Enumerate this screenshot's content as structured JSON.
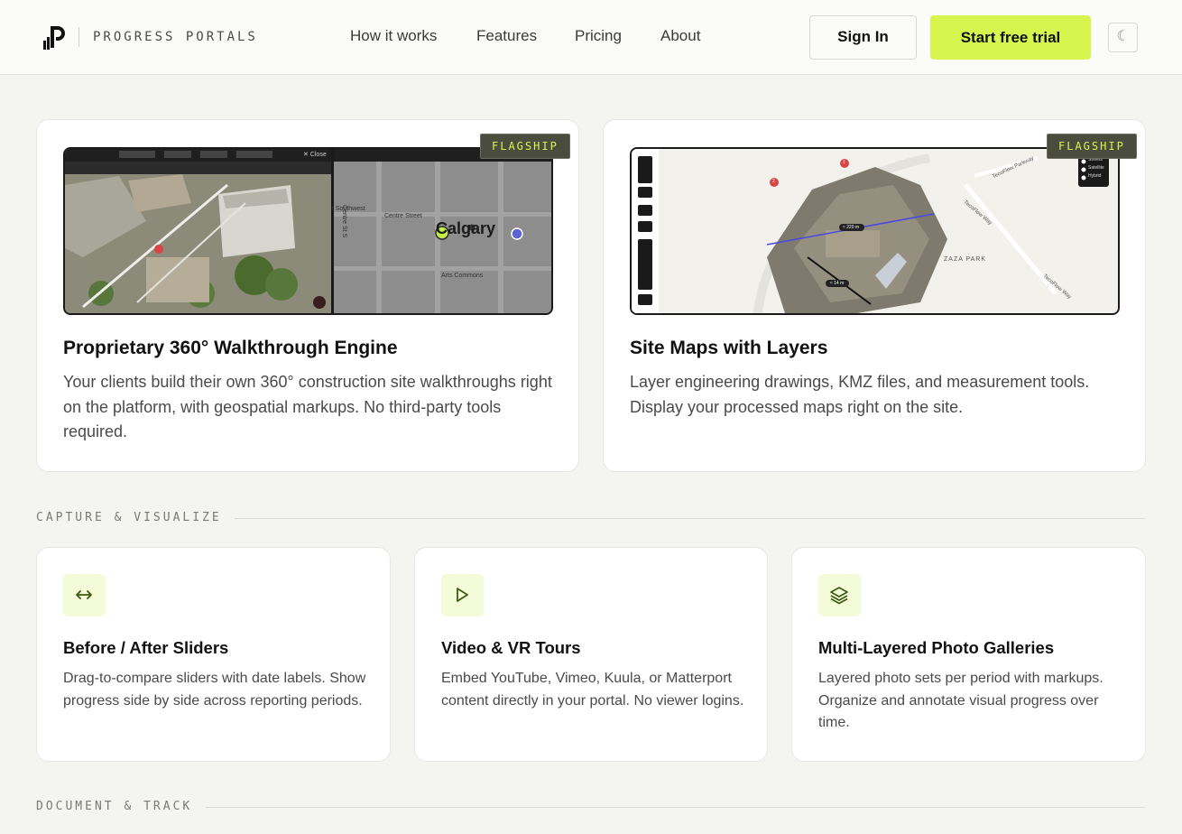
{
  "brand": {
    "name": "PROGRESS PORTALS"
  },
  "nav": {
    "items": [
      "How it works",
      "Features",
      "Pricing",
      "About"
    ],
    "sign_in": "Sign In",
    "start_trial": "Start free trial",
    "theme_toggle_glyph": "☾"
  },
  "flagship": [
    {
      "badge": "FLAGSHIP",
      "title": "Proprietary 360° Walkthrough Engine",
      "description": "Your clients build their own 360° construction site walkthroughs right on the platform, with geospatial markups. No third-party tools required.",
      "screenshot": {
        "map_city": "Calgary",
        "map_labels": [
          "t Southwest",
          "Centre Street",
          "Centre St S",
          "Arts Commons"
        ],
        "close_label": "✕ Close"
      }
    },
    {
      "badge": "FLAGSHIP",
      "title": "Site Maps with Layers",
      "description": "Layer engineering drawings, KMZ files, and measurement tools. Display your processed maps right on the site.",
      "screenshot": {
        "layer_options": [
          "Streets",
          "Satellite",
          "Hybrid"
        ],
        "map_labels": [
          "ZAZA PARK",
          "TecoFlow Parkway",
          "TecoFlow Way",
          "TecoFlow Way"
        ],
        "measure_labels": [
          "≈ 220 m",
          "≈ 14 m"
        ],
        "markers": [
          "1",
          "2"
        ]
      }
    }
  ],
  "sections": [
    {
      "label": "CAPTURE & VISUALIZE",
      "cards": [
        {
          "icon": "arrows-horizontal-icon",
          "title": "Before / After Sliders",
          "description": "Drag-to-compare sliders with date labels. Show progress side by side across reporting periods."
        },
        {
          "icon": "play-icon",
          "title": "Video & VR Tours",
          "description": "Embed YouTube, Vimeo, Kuula, or Matterport content directly in your portal. No viewer logins."
        },
        {
          "icon": "layers-icon",
          "title": "Multi-Layered Photo Galleries",
          "description": "Layered photo sets per period with markups. Organize and annotate visual progress over time."
        }
      ]
    },
    {
      "label": "DOCUMENT & TRACK"
    }
  ],
  "colors": {
    "accent": "#d7f54e",
    "badge_bg": "#4a4d3e",
    "background": "#f4f4f1"
  }
}
